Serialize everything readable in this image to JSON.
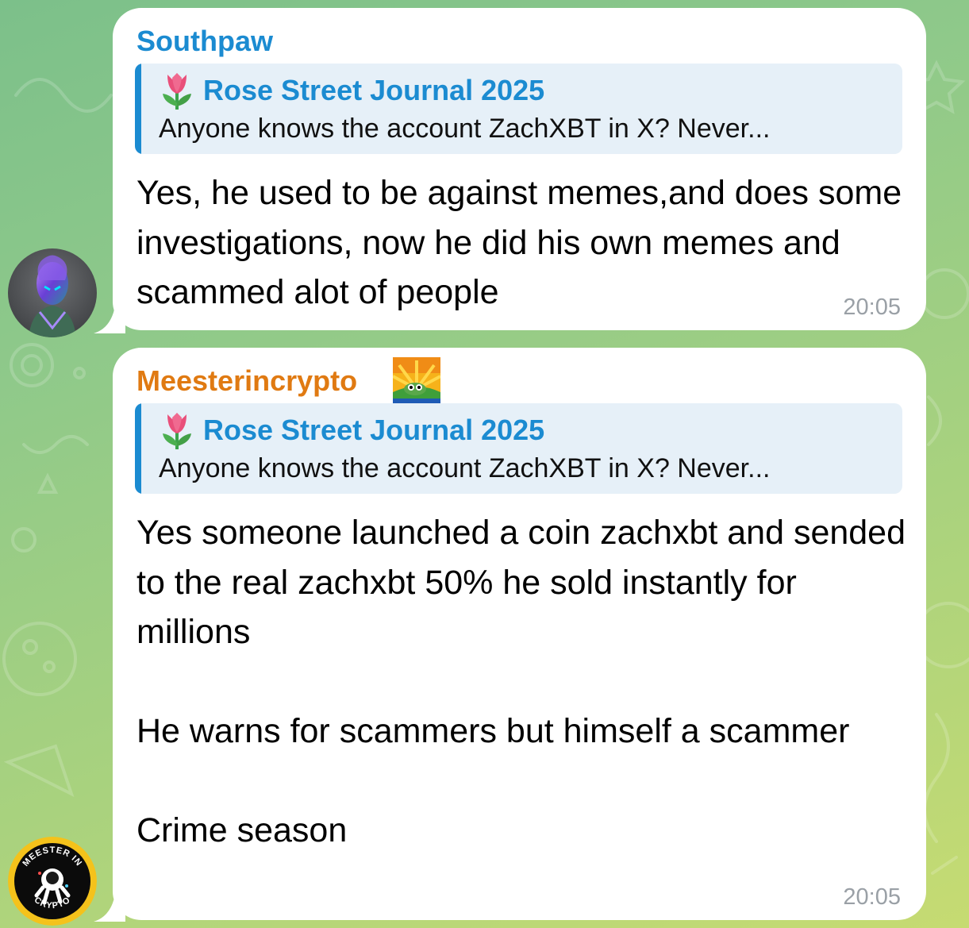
{
  "colors": {
    "sender_southpaw": "#1b8bd1",
    "sender_meester": "#e07a12",
    "reply_accent": "#1b8bd1",
    "reply_bg": "#e6f0f8",
    "timestamp": "#9aa0a6",
    "bubble": "#ffffff"
  },
  "messages": [
    {
      "sender": "Southpaw",
      "reply_to": {
        "emoji": "🌷",
        "title": "Rose Street Journal 2025",
        "text": "Anyone knows the account ZachXBT in X? Never..."
      },
      "text": "Yes, he used to be against memes,and does some investigations, now he did his own memes and scammed alot of people",
      "time": "20:05",
      "avatar_icon": "alien-avatar-icon"
    },
    {
      "sender": "Meesterincrypto",
      "sender_badge_icon": "pepe-sunrise-emoji-icon",
      "reply_to": {
        "emoji": "🌷",
        "title": "Rose Street Journal 2025",
        "text": "Anyone knows the account ZachXBT in X? Never..."
      },
      "text": "Yes someone launched a coin zachxbt and sended to the real zachxbt 50% he sold instantly for millions\n\nHe warns for scammers but himself a scammer\n\nCrime season",
      "time": "20:05",
      "avatar_icon": "meester-in-crypto-logo-icon",
      "avatar_logo_text": [
        "MEESTER IN",
        "CRYPTO"
      ]
    }
  ]
}
